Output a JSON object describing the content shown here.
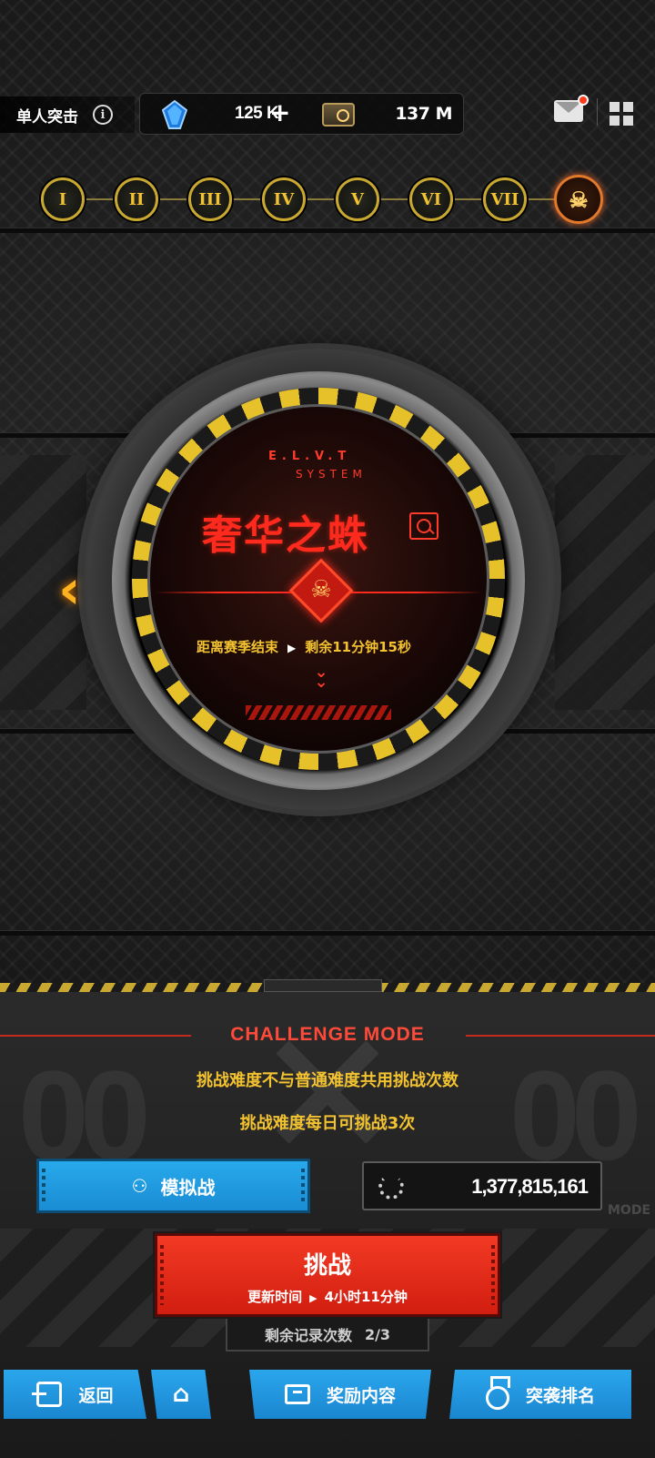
{
  "header": {
    "mode_title": "单人突击",
    "currency_crystal": "125 K",
    "currency_card": "137 M",
    "has_unread_mail": true
  },
  "stages": {
    "items": [
      "I",
      "II",
      "III",
      "IV",
      "V",
      "VI",
      "VII"
    ],
    "boss_icon": "skull-icon",
    "selected": "boss"
  },
  "dial": {
    "system_code": "E.L.V.T",
    "system_label": "SYSTEM",
    "boss_name": "奢华之蛛",
    "season_label": "距离赛季结束",
    "season_remaining": "剩余11分钟15秒"
  },
  "panel": {
    "title": "CHALLENGE MODE",
    "deco_left": "00",
    "deco_right": "00",
    "deco_mode": "MODE",
    "rule_1": "挑战难度不与普通难度共用挑战次数",
    "rule_2": "挑战难度每日可挑战3次",
    "simulate_label": "模拟战",
    "score": "1,377,815,161",
    "challenge_label": "挑战",
    "refresh_label": "更新时间",
    "refresh_time": "4小时11分钟",
    "remaining_label": "剩余记录次数",
    "remaining_value": "2/3"
  },
  "nav": {
    "back": "返回",
    "reward": "奖励内容",
    "rank": "突袭排名"
  },
  "colors": {
    "accent_gold": "#f2c230",
    "accent_red": "#ff2a1e",
    "button_blue": "#28a9ec",
    "button_red": "#f23a24"
  }
}
